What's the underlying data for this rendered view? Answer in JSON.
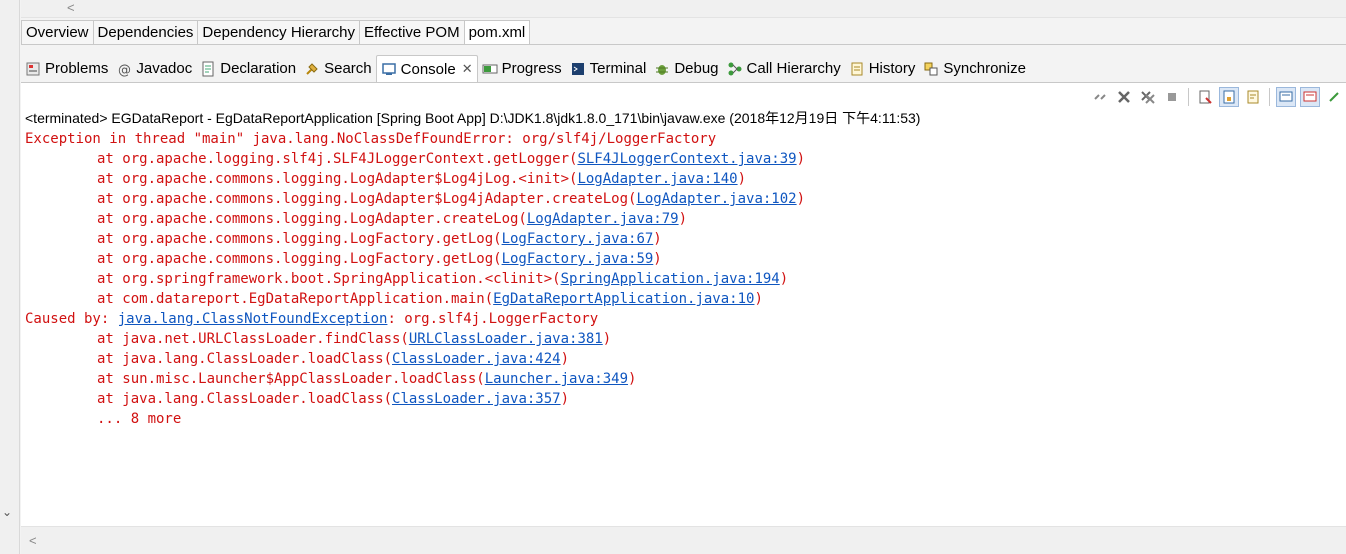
{
  "editor_tabs": [
    "Overview",
    "Dependencies",
    "Dependency Hierarchy",
    "Effective POM",
    "pom.xml"
  ],
  "view_tabs": [
    {
      "label": "Problems",
      "icon": "problems-icon"
    },
    {
      "label": "Javadoc",
      "icon": "javadoc-icon"
    },
    {
      "label": "Declaration",
      "icon": "declaration-icon"
    },
    {
      "label": "Search",
      "icon": "search-icon"
    },
    {
      "label": "Console",
      "icon": "console-icon",
      "active": true
    },
    {
      "label": "Progress",
      "icon": "progress-icon"
    },
    {
      "label": "Terminal",
      "icon": "terminal-icon"
    },
    {
      "label": "Debug",
      "icon": "debug-icon"
    },
    {
      "label": "Call Hierarchy",
      "icon": "call-hierarchy-icon"
    },
    {
      "label": "History",
      "icon": "history-icon"
    },
    {
      "label": "Synchronize",
      "icon": "synchronize-icon"
    }
  ],
  "console": {
    "close_glyph": "✕",
    "status": "<terminated> EGDataReport - EgDataReportApplication [Spring Boot App] D:\\JDK1.8\\jdk1.8.0_171\\bin\\javaw.exe (2018年12月19日 下午4:11:53)",
    "lines": [
      {
        "indent": false,
        "text": "Exception in thread \"main\" java.lang.NoClassDefFoundError: org/slf4j/LoggerFactory",
        "link": "",
        "suffix": ""
      },
      {
        "indent": true,
        "text": "at org.apache.logging.slf4j.SLF4JLoggerContext.getLogger(",
        "link": "SLF4JLoggerContext.java:39",
        "suffix": ")"
      },
      {
        "indent": true,
        "text": "at org.apache.commons.logging.LogAdapter$Log4jLog.<init>(",
        "link": "LogAdapter.java:140",
        "suffix": ")"
      },
      {
        "indent": true,
        "text": "at org.apache.commons.logging.LogAdapter$Log4jAdapter.createLog(",
        "link": "LogAdapter.java:102",
        "suffix": ")"
      },
      {
        "indent": true,
        "text": "at org.apache.commons.logging.LogAdapter.createLog(",
        "link": "LogAdapter.java:79",
        "suffix": ")"
      },
      {
        "indent": true,
        "text": "at org.apache.commons.logging.LogFactory.getLog(",
        "link": "LogFactory.java:67",
        "suffix": ")"
      },
      {
        "indent": true,
        "text": "at org.apache.commons.logging.LogFactory.getLog(",
        "link": "LogFactory.java:59",
        "suffix": ")"
      },
      {
        "indent": true,
        "text": "at org.springframework.boot.SpringApplication.<clinit>(",
        "link": "SpringApplication.java:194",
        "suffix": ")"
      },
      {
        "indent": true,
        "text": "at com.datareport.EgDataReportApplication.main(",
        "link": "EgDataReportApplication.java:10",
        "suffix": ")"
      },
      {
        "indent": false,
        "text": "Caused by: ",
        "link": "java.lang.ClassNotFoundException",
        "suffix": ": org.slf4j.LoggerFactory"
      },
      {
        "indent": true,
        "text": "at java.net.URLClassLoader.findClass(",
        "link": "URLClassLoader.java:381",
        "suffix": ")"
      },
      {
        "indent": true,
        "text": "at java.lang.ClassLoader.loadClass(",
        "link": "ClassLoader.java:424",
        "suffix": ")"
      },
      {
        "indent": true,
        "text": "at sun.misc.Launcher$AppClassLoader.loadClass(",
        "link": "Launcher.java:349",
        "suffix": ")"
      },
      {
        "indent": true,
        "text": "at java.lang.ClassLoader.loadClass(",
        "link": "ClassLoader.java:357",
        "suffix": ")"
      },
      {
        "indent": true,
        "text": "... 8 more",
        "link": "",
        "suffix": ""
      }
    ]
  },
  "colors": {
    "error": "#d11111",
    "link": "#0f56c0"
  }
}
